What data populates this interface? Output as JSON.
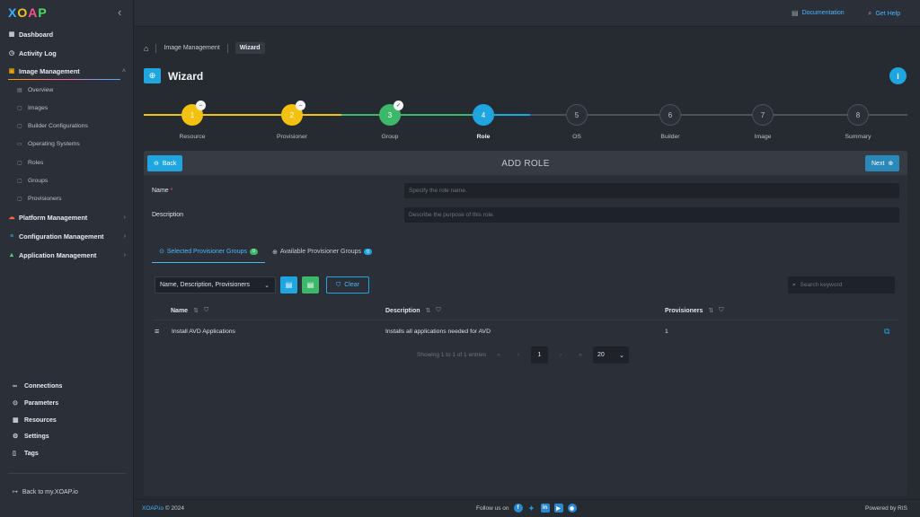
{
  "app": {
    "logo": [
      "X",
      "O",
      "A",
      "P"
    ],
    "collapse_glyph": "‹"
  },
  "sidebar": {
    "items": [
      {
        "label": "Dashboard",
        "icon": "dashboard-icon"
      },
      {
        "label": "Activity Log",
        "icon": "clock-icon"
      },
      {
        "label": "Image Management",
        "icon": "image-icon",
        "expanded": true
      },
      {
        "label": "Platform Management",
        "icon": "platform-icon"
      },
      {
        "label": "Configuration Management",
        "icon": "config-icon"
      },
      {
        "label": "Application Management",
        "icon": "app-icon"
      }
    ],
    "sub_items": [
      "Overview",
      "Images",
      "Builder Configurations",
      "Operating Systems",
      "Roles",
      "Groups",
      "Provisioners"
    ],
    "bottom_items": [
      "Connections",
      "Parameters",
      "Resources",
      "Settings",
      "Tags"
    ],
    "back_link": "Back to my.XOAP.io"
  },
  "topbar": {
    "documentation": "Documentation",
    "get_help": "Get Help"
  },
  "breadcrumb": {
    "items": [
      "Image Management",
      "Wizard"
    ]
  },
  "page": {
    "title": "Wizard",
    "info": "i"
  },
  "stepper": {
    "steps": [
      {
        "num": "1",
        "label": "Resource",
        "state": "warning"
      },
      {
        "num": "2",
        "label": "Provisioner",
        "state": "warning"
      },
      {
        "num": "3",
        "label": "Group",
        "state": "done"
      },
      {
        "num": "4",
        "label": "Role",
        "state": "current"
      },
      {
        "num": "5",
        "label": "OS",
        "state": "idle"
      },
      {
        "num": "6",
        "label": "Builder",
        "state": "idle"
      },
      {
        "num": "7",
        "label": "Image",
        "state": "idle"
      },
      {
        "num": "8",
        "label": "Summary",
        "state": "idle"
      }
    ],
    "colors": {
      "warning": "#f3c10f",
      "done": "#3db86a",
      "current": "#1fa6e0"
    }
  },
  "form": {
    "back_label": "Back",
    "title": "ADD ROLE",
    "next_label": "Next",
    "name_label": "Name",
    "name_required": "*",
    "name_placeholder": "Specify the role name.",
    "description_label": "Description",
    "description_placeholder": "Describe the purpose of this role."
  },
  "tabs": [
    {
      "label": "Selected Provisioner Groups",
      "count": "0",
      "active": true
    },
    {
      "label": "Available Provisioner Groups",
      "count": "0",
      "active": false
    }
  ],
  "toolbar": {
    "columns_select": "Name, Description, Provisioners",
    "clear_label": "Clear",
    "search_placeholder": "Search keyword"
  },
  "table": {
    "columns": [
      "Name",
      "Description",
      "Provisioners"
    ],
    "rows": [
      {
        "name": "Install AVD Applications",
        "description": "Installs all applications needed for AVD",
        "provisioners": "1"
      }
    ]
  },
  "pagination": {
    "summary": "Showing 1 to 1 of 1 entries",
    "current_page": "1",
    "page_size": "20"
  },
  "footer": {
    "brand": "XOAP.io",
    "copyright": "© 2024",
    "follow": "Follow us on",
    "powered": "Powered by RIS"
  }
}
